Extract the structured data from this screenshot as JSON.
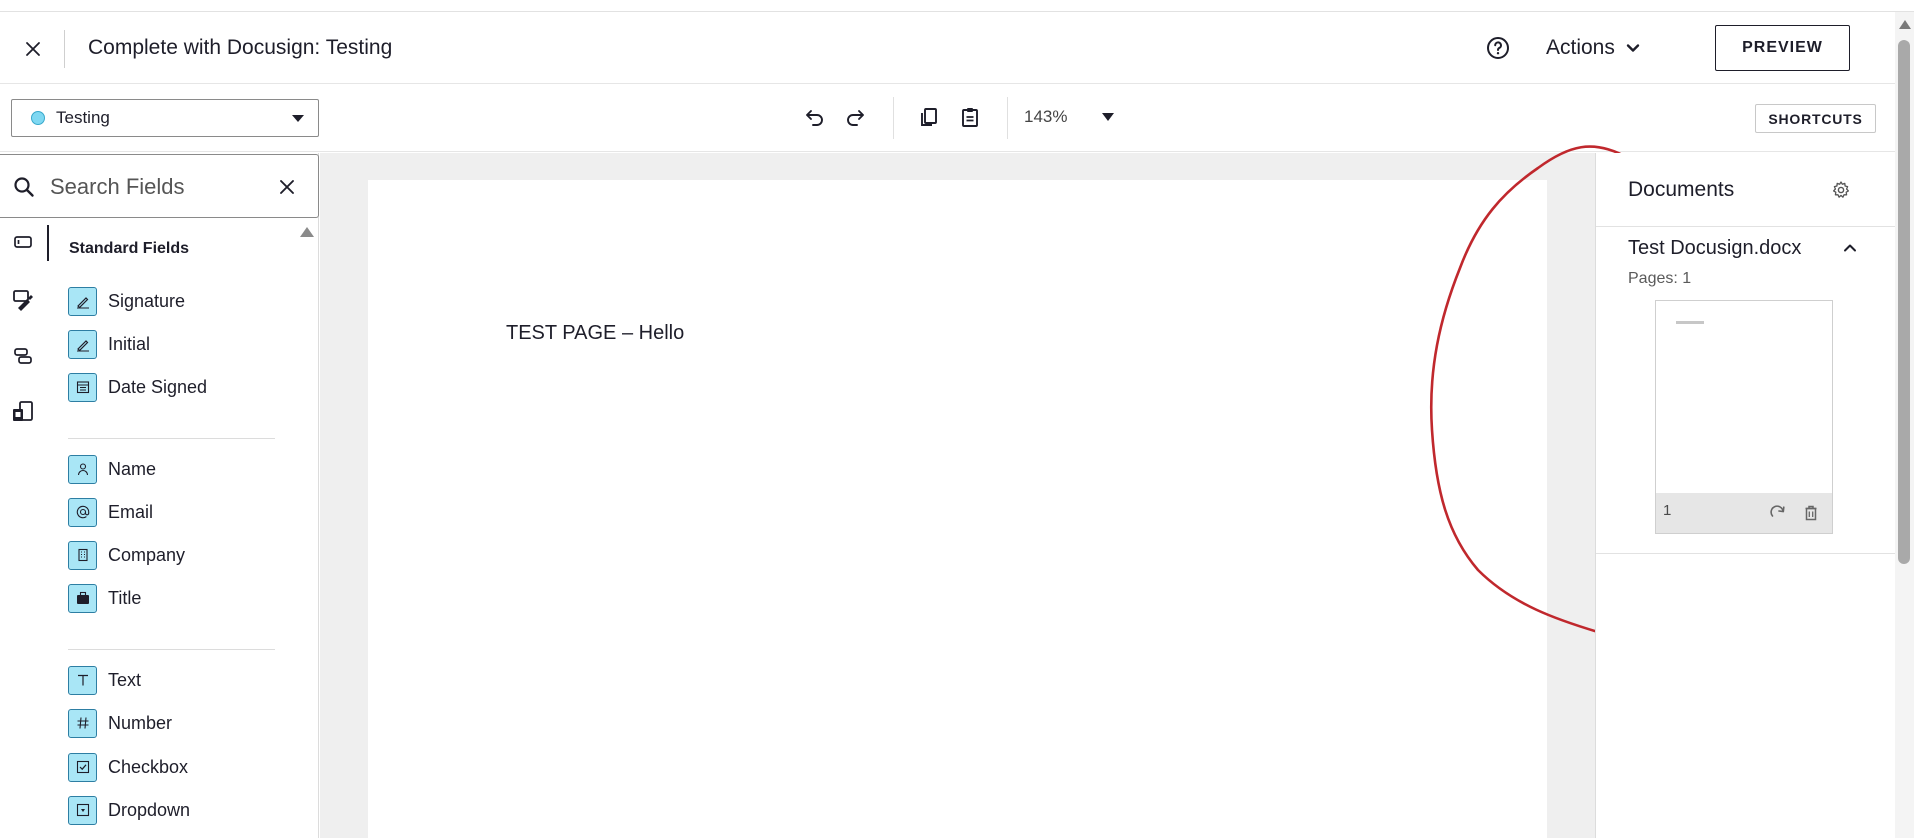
{
  "header": {
    "title": "Complete with Docusign: Testing",
    "actions_label": "Actions",
    "preview_label": "PREVIEW"
  },
  "toolbar": {
    "recipient": "Testing",
    "zoom": "143%",
    "shortcuts_label": "SHORTCUTS"
  },
  "search": {
    "placeholder": "Search Fields"
  },
  "fields": {
    "heading": "Standard Fields",
    "groups": [
      [
        {
          "label": "Signature",
          "icon": "pen-icon"
        },
        {
          "label": "Initial",
          "icon": "pen-icon"
        },
        {
          "label": "Date Signed",
          "icon": "calendar-icon"
        }
      ],
      [
        {
          "label": "Name",
          "icon": "person-icon"
        },
        {
          "label": "Email",
          "icon": "at-sign-icon"
        },
        {
          "label": "Company",
          "icon": "building-icon"
        },
        {
          "label": "Title",
          "icon": "briefcase-icon"
        }
      ],
      [
        {
          "label": "Text",
          "icon": "text-t-icon"
        },
        {
          "label": "Number",
          "icon": "hash-icon"
        },
        {
          "label": "Checkbox",
          "icon": "checkbox-icon"
        },
        {
          "label": "Dropdown",
          "icon": "dropdown-icon"
        }
      ]
    ]
  },
  "document": {
    "page_text": "TEST PAGE – Hello"
  },
  "documents_panel": {
    "title": "Documents",
    "doc_name": "Test Docusign.docx",
    "pages_label": "Pages: 1",
    "thumb_page_number": "1"
  },
  "colors": {
    "accent_field_bg": "#a9e6f6",
    "accent_field_border": "#2d7ea3",
    "annotation_red": "#c0282d",
    "recipient_dot": "#7fd8f2"
  }
}
